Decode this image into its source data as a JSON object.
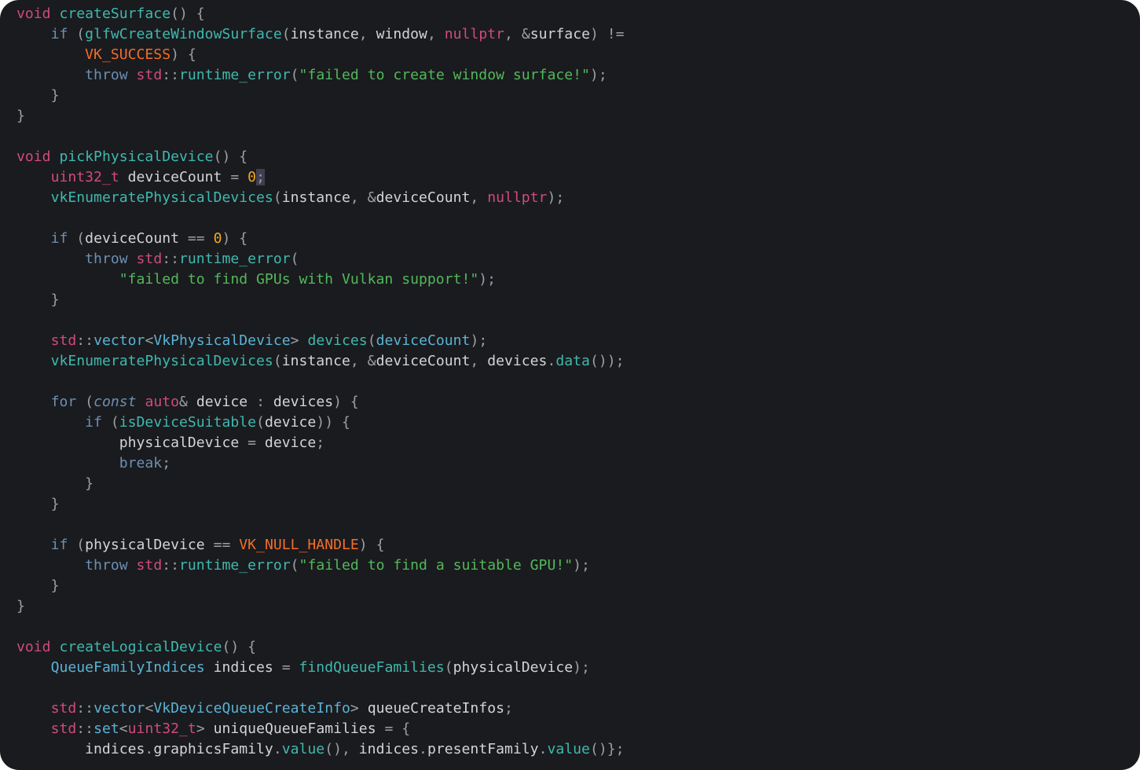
{
  "editor": {
    "colors": {
      "background": "#1a1b1e",
      "keyword": "#d04a7e",
      "control": "#6c8fb4",
      "function": "#3fb8b0",
      "identifier": "#d4d4d8",
      "punctuation": "#9aa0a6",
      "constant": "#f36d2a",
      "string": "#52b85c",
      "number": "#f0a91e",
      "type": "#5ab3d6"
    },
    "lines": [
      [
        [
          "kw",
          "void"
        ],
        [
          "id",
          " "
        ],
        [
          "fn",
          "createSurface"
        ],
        [
          "punc",
          "() {"
        ]
      ],
      [
        [
          "id",
          "    "
        ],
        [
          "kw2",
          "if"
        ],
        [
          "punc",
          " ("
        ],
        [
          "fn",
          "glfwCreateWindowSurface"
        ],
        [
          "punc",
          "("
        ],
        [
          "id",
          "instance"
        ],
        [
          "punc",
          ", "
        ],
        [
          "id",
          "window"
        ],
        [
          "punc",
          ", "
        ],
        [
          "kw",
          "nullptr"
        ],
        [
          "punc",
          ", "
        ],
        [
          "punc",
          "&"
        ],
        [
          "id",
          "surface"
        ],
        [
          "punc",
          ") !="
        ]
      ],
      [
        [
          "id",
          "        "
        ],
        [
          "const",
          "VK_SUCCESS"
        ],
        [
          "punc",
          ") {"
        ]
      ],
      [
        [
          "id",
          "        "
        ],
        [
          "kw2",
          "throw"
        ],
        [
          "id",
          " "
        ],
        [
          "kw",
          "std"
        ],
        [
          "punc",
          "::"
        ],
        [
          "fn",
          "runtime_error"
        ],
        [
          "punc",
          "("
        ],
        [
          "str",
          "\"failed to create window surface!\""
        ],
        [
          "punc",
          ");"
        ]
      ],
      [
        [
          "id",
          "    "
        ],
        [
          "punc",
          "}"
        ]
      ],
      [
        [
          "punc",
          "}"
        ]
      ],
      [],
      [
        [
          "kw",
          "void"
        ],
        [
          "id",
          " "
        ],
        [
          "fn",
          "pickPhysicalDevice"
        ],
        [
          "punc",
          "() {"
        ]
      ],
      [
        [
          "id",
          "    "
        ],
        [
          "kw",
          "uint32_t"
        ],
        [
          "id",
          " deviceCount "
        ],
        [
          "punc",
          "= "
        ],
        [
          "num",
          "0"
        ],
        [
          "cursor",
          ";"
        ]
      ],
      [
        [
          "id",
          "    "
        ],
        [
          "fn",
          "vkEnumeratePhysicalDevices"
        ],
        [
          "punc",
          "("
        ],
        [
          "id",
          "instance"
        ],
        [
          "punc",
          ", &"
        ],
        [
          "id",
          "deviceCount"
        ],
        [
          "punc",
          ", "
        ],
        [
          "kw",
          "nullptr"
        ],
        [
          "punc",
          ");"
        ]
      ],
      [],
      [
        [
          "id",
          "    "
        ],
        [
          "kw2",
          "if"
        ],
        [
          "punc",
          " ("
        ],
        [
          "id",
          "deviceCount "
        ],
        [
          "punc",
          "== "
        ],
        [
          "num",
          "0"
        ],
        [
          "punc",
          ") {"
        ]
      ],
      [
        [
          "id",
          "        "
        ],
        [
          "kw2",
          "throw"
        ],
        [
          "id",
          " "
        ],
        [
          "kw",
          "std"
        ],
        [
          "punc",
          "::"
        ],
        [
          "fn",
          "runtime_error"
        ],
        [
          "punc",
          "("
        ]
      ],
      [
        [
          "id",
          "            "
        ],
        [
          "str",
          "\"failed to find GPUs with Vulkan support!\""
        ],
        [
          "punc",
          ");"
        ]
      ],
      [
        [
          "id",
          "    "
        ],
        [
          "punc",
          "}"
        ]
      ],
      [],
      [
        [
          "id",
          "    "
        ],
        [
          "kw",
          "std"
        ],
        [
          "punc",
          "::"
        ],
        [
          "type",
          "vector"
        ],
        [
          "punc",
          "<"
        ],
        [
          "type",
          "VkPhysicalDevice"
        ],
        [
          "punc",
          "> "
        ],
        [
          "fn",
          "devices"
        ],
        [
          "punc",
          "("
        ],
        [
          "type",
          "deviceCount"
        ],
        [
          "punc",
          ");"
        ]
      ],
      [
        [
          "id",
          "    "
        ],
        [
          "fn",
          "vkEnumeratePhysicalDevices"
        ],
        [
          "punc",
          "("
        ],
        [
          "id",
          "instance"
        ],
        [
          "punc",
          ", &"
        ],
        [
          "id",
          "deviceCount"
        ],
        [
          "punc",
          ", "
        ],
        [
          "id",
          "devices"
        ],
        [
          "punc",
          "."
        ],
        [
          "fn",
          "data"
        ],
        [
          "punc",
          "());"
        ]
      ],
      [],
      [
        [
          "id",
          "    "
        ],
        [
          "kw2",
          "for"
        ],
        [
          "punc",
          " ("
        ],
        [
          "it",
          "const"
        ],
        [
          "id",
          " "
        ],
        [
          "kw",
          "auto"
        ],
        [
          "punc",
          "&"
        ],
        [
          "id",
          " device "
        ],
        [
          "punc",
          ": "
        ],
        [
          "id",
          "devices"
        ],
        [
          "punc",
          ") {"
        ]
      ],
      [
        [
          "id",
          "        "
        ],
        [
          "kw2",
          "if"
        ],
        [
          "punc",
          " ("
        ],
        [
          "fn",
          "isDeviceSuitable"
        ],
        [
          "punc",
          "("
        ],
        [
          "id",
          "device"
        ],
        [
          "punc",
          ")) {"
        ]
      ],
      [
        [
          "id",
          "            physicalDevice "
        ],
        [
          "punc",
          "= "
        ],
        [
          "id",
          "device"
        ],
        [
          "punc",
          ";"
        ]
      ],
      [
        [
          "id",
          "            "
        ],
        [
          "kw2",
          "break"
        ],
        [
          "punc",
          ";"
        ]
      ],
      [
        [
          "id",
          "        "
        ],
        [
          "punc",
          "}"
        ]
      ],
      [
        [
          "id",
          "    "
        ],
        [
          "punc",
          "}"
        ]
      ],
      [],
      [
        [
          "id",
          "    "
        ],
        [
          "kw2",
          "if"
        ],
        [
          "punc",
          " ("
        ],
        [
          "id",
          "physicalDevice "
        ],
        [
          "punc",
          "== "
        ],
        [
          "const",
          "VK_NULL_HANDLE"
        ],
        [
          "punc",
          ") {"
        ]
      ],
      [
        [
          "id",
          "        "
        ],
        [
          "kw2",
          "throw"
        ],
        [
          "id",
          " "
        ],
        [
          "kw",
          "std"
        ],
        [
          "punc",
          "::"
        ],
        [
          "fn",
          "runtime_error"
        ],
        [
          "punc",
          "("
        ],
        [
          "str",
          "\"failed to find a suitable GPU!\""
        ],
        [
          "punc",
          ");"
        ]
      ],
      [
        [
          "id",
          "    "
        ],
        [
          "punc",
          "}"
        ]
      ],
      [
        [
          "punc",
          "}"
        ]
      ],
      [],
      [
        [
          "kw",
          "void"
        ],
        [
          "id",
          " "
        ],
        [
          "fn",
          "createLogicalDevice"
        ],
        [
          "punc",
          "() {"
        ]
      ],
      [
        [
          "id",
          "    "
        ],
        [
          "type",
          "QueueFamilyIndices"
        ],
        [
          "id",
          " indices "
        ],
        [
          "punc",
          "= "
        ],
        [
          "fn",
          "findQueueFamilies"
        ],
        [
          "punc",
          "("
        ],
        [
          "id",
          "physicalDevice"
        ],
        [
          "punc",
          ");"
        ]
      ],
      [],
      [
        [
          "id",
          "    "
        ],
        [
          "kw",
          "std"
        ],
        [
          "punc",
          "::"
        ],
        [
          "type",
          "vector"
        ],
        [
          "punc",
          "<"
        ],
        [
          "type",
          "VkDeviceQueueCreateInfo"
        ],
        [
          "punc",
          "> "
        ],
        [
          "id",
          "queueCreateInfos"
        ],
        [
          "punc",
          ";"
        ]
      ],
      [
        [
          "id",
          "    "
        ],
        [
          "kw",
          "std"
        ],
        [
          "punc",
          "::"
        ],
        [
          "type",
          "set"
        ],
        [
          "punc",
          "<"
        ],
        [
          "kw",
          "uint32_t"
        ],
        [
          "punc",
          "> "
        ],
        [
          "id",
          "uniqueQueueFamilies "
        ],
        [
          "punc",
          "= {"
        ]
      ],
      [
        [
          "id",
          "        indices"
        ],
        [
          "punc",
          "."
        ],
        [
          "id",
          "graphicsFamily"
        ],
        [
          "punc",
          "."
        ],
        [
          "fn",
          "value"
        ],
        [
          "punc",
          "(), "
        ],
        [
          "id",
          "indices"
        ],
        [
          "punc",
          "."
        ],
        [
          "id",
          "presentFamily"
        ],
        [
          "punc",
          "."
        ],
        [
          "fn",
          "value"
        ],
        [
          "punc",
          "()};"
        ]
      ]
    ]
  }
}
